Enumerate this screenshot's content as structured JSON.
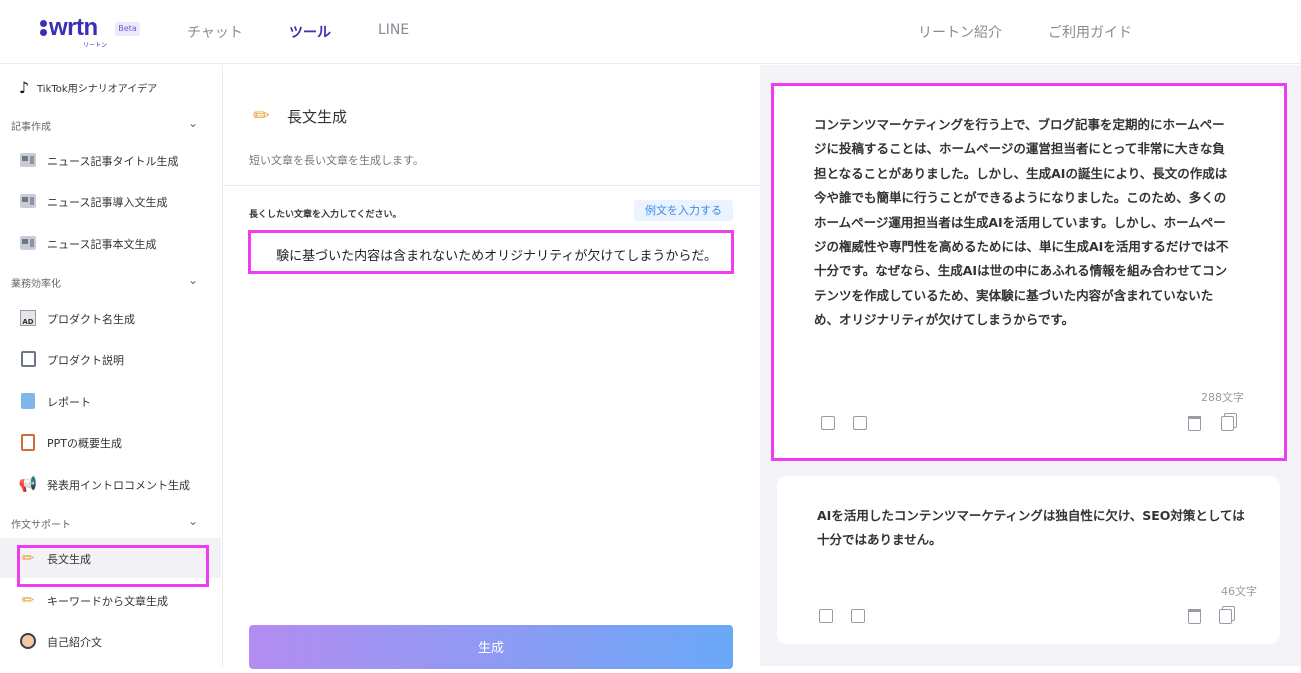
{
  "header": {
    "logo_text": "wrtn",
    "logo_sub": "リートン",
    "beta": "Beta",
    "nav": [
      "チャット",
      "ツール",
      "LINE"
    ],
    "active_nav": "ツール",
    "right_nav": [
      "リートン紹介",
      "ご利用ガイド"
    ]
  },
  "sidebar": {
    "top_item": "TikTok用シナリオアイデア",
    "sections": [
      {
        "label": "記事作成",
        "chevron": "chevron-down-icon",
        "items": [
          "ニュース記事タイトル生成",
          "ニュース記事導入文生成",
          "ニュース記事本文生成"
        ]
      },
      {
        "label": "業務効率化",
        "chevron": "chevron-down-icon",
        "items": [
          "プロダクト名生成",
          "プロダクト説明",
          "レポート",
          "PPTの概要生成",
          "発表用イントロコメント生成"
        ]
      },
      {
        "label": "作文サポート",
        "chevron": "chevron-down-icon",
        "items": [
          "長文生成",
          "キーワードから文章生成",
          "自己紹介文"
        ]
      }
    ],
    "active_item": "長文生成"
  },
  "tool": {
    "title": "長文生成",
    "description": "短い文章を長い文章を生成します。",
    "input_label": "長くしたい文章を入力してください。",
    "example_button": "例文を入力する",
    "input_value": "験に基づいた内容は含まれないためオリジナリティが欠けてしまうからだ。",
    "generate_button": "生成"
  },
  "results": [
    {
      "text": "コンテンツマーケティングを行う上で、ブログ記事を定期的にホームページに投稿することは、ホームページの運営担当者にとって非常に大きな負担となることがありました。しかし、生成AIの誕生により、長文の作成は今や誰でも簡単に行うことができるようになりました。このため、多くのホームページ運用担当者は生成AIを活用しています。しかし、ホームページの権威性や専門性を高めるためには、単に生成AIを活用するだけでは不十分です。なぜなら、生成AIは世の中にあふれる情報を組み合わせてコンテンツを作成しているため、実体験に基づいた内容が含まれていないため、オリジナリティが欠けてしまうからです。",
      "count": "288文字"
    },
    {
      "text": "AIを活用したコンテンツマーケティングは独自性に欠け、SEO対策としては十分ではありません。",
      "count": "46文字"
    }
  ],
  "colors": {
    "brand": "#3b2fb3",
    "highlight": "#f03cf0",
    "link": "#3a8be8"
  }
}
